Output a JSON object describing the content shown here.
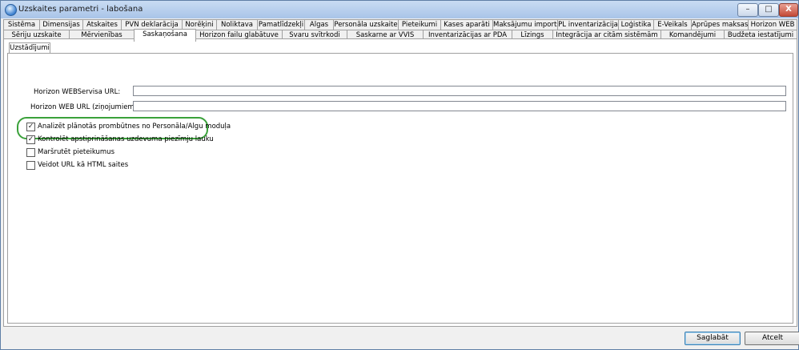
{
  "window": {
    "title": "Uzskaites parametri - labošana"
  },
  "title_buttons": {
    "minimize": "–",
    "maximize": "□",
    "close": "X"
  },
  "tabs_row1": [
    "Sistēma",
    "Dimensijas",
    "Atskaites",
    "PVN deklarācija",
    "Norēķini",
    "Noliktava",
    "Pamatlīdzekļi",
    "Algas",
    "Personāla uzskaite",
    "Pieteikumi",
    "Kases aparāti",
    "Maksājumu imports",
    "PL inventarizācija",
    "Loģistika",
    "E-Veikals",
    "Aprūpes maksas",
    "Horizon WEB"
  ],
  "tabs_row2": [
    "Sēriju uzskaite",
    "Mērvienības",
    "Saskaņošana",
    "Horizon failu glabātuve",
    "Svaru svītrkodi",
    "Saskarne ar VVIS",
    "Inventarizācijas ar PDA",
    "Līzings",
    "Integrācija ar citām sistēmām",
    "Komandējumi",
    "Budžeta iestatījumi"
  ],
  "active_tab": "Saskaņošana",
  "subtab": "Uzstādījumi",
  "fields": [
    {
      "label": "Horizon WEBServisa URL:",
      "value": ""
    },
    {
      "label": "Horizon WEB URL (ziņojumiem):",
      "value": ""
    }
  ],
  "checkboxes": [
    {
      "label": "Analizēt plānotās prombūtnes no Personāla/Algu moduļa",
      "checked": true,
      "mark": "✓"
    },
    {
      "label": "Kontrolēt apstiprināšanas uzdevuma piezīmju lauku",
      "checked": true,
      "mark": "✓"
    },
    {
      "label": "Maršrutēt pieteikumus",
      "checked": false,
      "mark": ""
    },
    {
      "label": "Veidot URL kā HTML saites",
      "checked": false,
      "mark": ""
    }
  ],
  "footer": {
    "save": "Saglabāt",
    "cancel": "Atcelt"
  },
  "colors": {
    "highlight": "#3aa13a",
    "titlebar": "#b9d1f0"
  }
}
